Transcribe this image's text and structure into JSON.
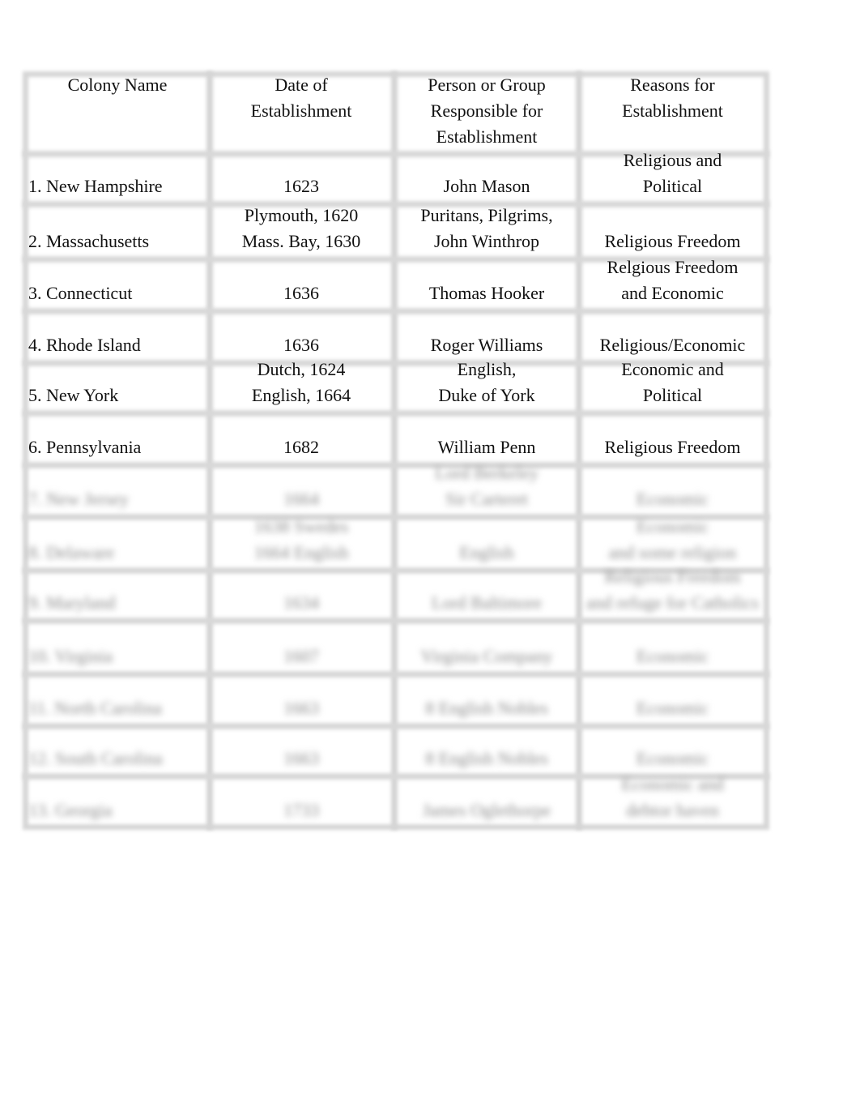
{
  "headers": [
    "Colony Name",
    "Date of Establishment",
    "Person or Group Responsible for Establishment",
    "Reasons for Establishment"
  ],
  "rows": [
    {
      "name": "1. New Hampshire",
      "date": [
        "1623"
      ],
      "person": [
        "John Mason"
      ],
      "reason": [
        "Religious and",
        "Political"
      ]
    },
    {
      "name": "2. Massachusetts",
      "date": [
        "Plymouth, 1620",
        "Mass. Bay, 1630"
      ],
      "person": [
        "Puritans, Pilgrims,",
        "John Winthrop"
      ],
      "reason": [
        "Religious Freedom"
      ]
    },
    {
      "name": "3. Connecticut",
      "date": [
        "1636"
      ],
      "person": [
        "Thomas Hooker"
      ],
      "reason": [
        "Relgious Freedom",
        "and Economic"
      ]
    },
    {
      "name": "4. Rhode Island",
      "date": [
        "1636"
      ],
      "person": [
        "Roger Williams"
      ],
      "reason": [
        "Religious/Economic"
      ]
    },
    {
      "name": "5. New York",
      "date": [
        "Dutch, 1624",
        "English, 1664"
      ],
      "person": [
        "English,",
        "Duke of York"
      ],
      "reason": [
        "Economic and",
        "Political"
      ]
    },
    {
      "name": "6. Pennsylvania",
      "date": [
        "1682"
      ],
      "person": [
        "William Penn"
      ],
      "reason": [
        "Religious Freedom"
      ]
    },
    {
      "name": "7. New Jersey",
      "date": [
        "1664"
      ],
      "person": [
        "Lord Berkeley",
        "Sir Carteret"
      ],
      "reason": [
        "Economic"
      ]
    },
    {
      "name": "8. Delaware",
      "date": [
        "1638 Swedes",
        "1664 English"
      ],
      "person": [
        "English"
      ],
      "reason": [
        "Economic",
        "and some religion"
      ]
    },
    {
      "name": "9. Maryland",
      "date": [
        "1634"
      ],
      "person": [
        "Lord Baltimore"
      ],
      "reason": [
        "Religious Freedom",
        "and refuge for Catholics"
      ]
    },
    {
      "name": "10. Virginia",
      "date": [
        "1607"
      ],
      "person": [
        "Virginia Company"
      ],
      "reason": [
        "Economic"
      ]
    },
    {
      "name": "11. North Carolina",
      "date": [
        "1663"
      ],
      "person": [
        "8 English Nobles"
      ],
      "reason": [
        "Economic"
      ]
    },
    {
      "name": "12. South Carolina",
      "date": [
        "1663"
      ],
      "person": [
        "8 English Nobles"
      ],
      "reason": [
        "Economic"
      ]
    },
    {
      "name": "13. Georgia",
      "date": [
        "1733"
      ],
      "person": [
        "James Oglethorpe"
      ],
      "reason": [
        "Economic and",
        "debtor haven"
      ]
    }
  ]
}
